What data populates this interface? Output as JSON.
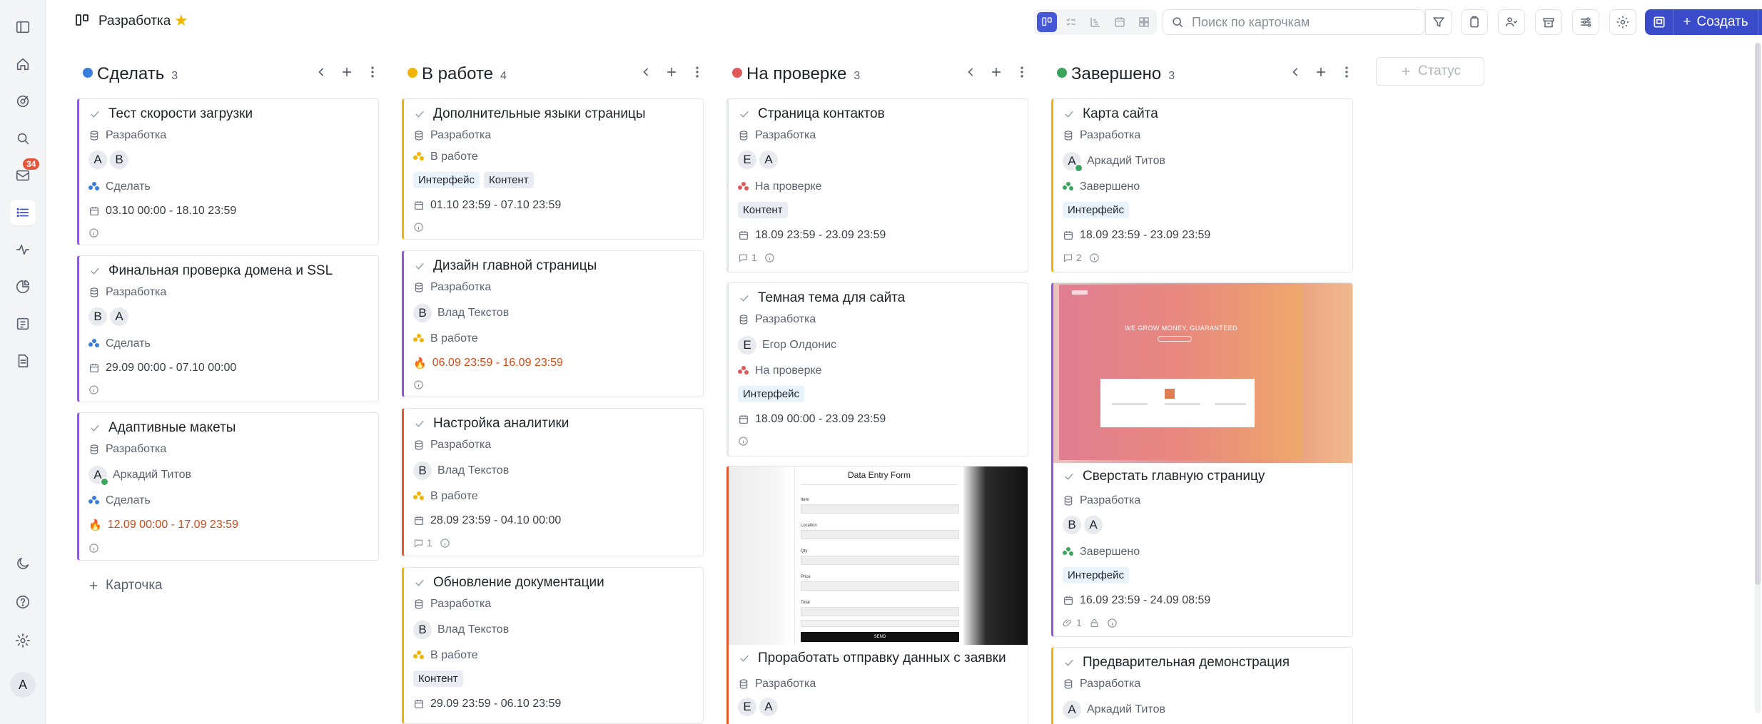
{
  "project": {
    "title": "Разработка"
  },
  "sidebar": {
    "inbox_badge": "34",
    "avatar": "А"
  },
  "toolbar": {
    "search_placeholder": "Поиск по карточкам",
    "create_label": "Создать"
  },
  "board": {
    "add_card_label": "Карточка",
    "add_status_label": "Статус",
    "columns": [
      {
        "title": "Сделать",
        "count": "3",
        "color": "#3b7ddd",
        "cards": [
          {
            "title": "Тест скорости загрузки",
            "project": "Разработка",
            "avatars": [
              "А",
              "В"
            ],
            "status": "Сделать",
            "date": "03.10 00:00 - 18.10 23:59"
          },
          {
            "title": "Финальная проверка домена и SSL",
            "project": "Разработка",
            "avatars": [
              "В",
              "А"
            ],
            "status": "Сделать",
            "date": "29.09 00:00 - 07.10 00:00"
          },
          {
            "title": "Адаптивные макеты",
            "project": "Разработка",
            "avatars": [
              "А"
            ],
            "assignee": "Аркадий Титов",
            "status": "Сделать",
            "date": "12.09 00:00 - 17.09 23:59"
          }
        ]
      },
      {
        "title": "В работе",
        "count": "4",
        "color": "#f0b400",
        "cards": [
          {
            "title": "Дополнительные языки страницы",
            "project": "Разработка",
            "status": "В работе",
            "tags": [
              "Интерфейс",
              "Контент"
            ],
            "date": "01.10 23:59 - 07.10 23:59"
          },
          {
            "title": "Дизайн главной страницы",
            "project": "Разработка",
            "avatars": [
              "В"
            ],
            "assignee": "Влад Текстов",
            "status": "В работе",
            "date": "06.09 23:59 - 16.09 23:59"
          },
          {
            "title": "Настройка аналитики",
            "project": "Разработка",
            "avatars": [
              "В"
            ],
            "assignee": "Влад Текстов",
            "status": "В работе",
            "date": "28.09 23:59 - 04.10 00:00",
            "comments": "1"
          },
          {
            "title": "Обновление документации",
            "project": "Разработка",
            "avatars": [
              "В"
            ],
            "assignee": "Влад Текстов",
            "status": "В работе",
            "tags": [
              "Контент"
            ],
            "date": "29.09 23:59 - 06.10 23:59"
          }
        ]
      },
      {
        "title": "На проверке",
        "count": "3",
        "color": "#e05a5a",
        "cards": [
          {
            "title": "Страница контактов",
            "project": "Разработка",
            "avatars": [
              "Е",
              "А"
            ],
            "status": "На проверке",
            "tags": [
              "Контент"
            ],
            "date": "18.09 23:59 - 23.09 23:59",
            "comments": "1"
          },
          {
            "title": "Темная тема для сайта",
            "project": "Разработка",
            "avatars": [
              "Е"
            ],
            "assignee": "Егор Олдонис",
            "status": "На проверке",
            "tags": [
              "Интерфейс"
            ],
            "date": "18.09 00:00 - 23.09 23:59"
          },
          {
            "title": "Проработать отправку данных с заявки",
            "project": "Разработка",
            "avatars": [
              "Е",
              "А"
            ],
            "cover": {
              "form_title": "Data Entry Form",
              "labels": [
                "Item",
                "Location",
                "Qty",
                "Price",
                "Total"
              ],
              "send": "SEND"
            }
          }
        ]
      },
      {
        "title": "Завершено",
        "count": "3",
        "color": "#3aa55d",
        "cards": [
          {
            "title": "Карта сайта",
            "project": "Разработка",
            "avatars": [
              "А"
            ],
            "assignee": "Аркадий Титов",
            "status": "Завершено",
            "tags": [
              "Интерфейс"
            ],
            "date": "18.09 23:59 - 23.09 23:59",
            "comments": "2"
          },
          {
            "title": "Сверстать главную страницу",
            "project": "Разработка",
            "avatars": [
              "В",
              "А"
            ],
            "status": "Завершено",
            "tags": [
              "Интерфейс"
            ],
            "date": "16.09 23:59 - 24.09 08:59",
            "attachments": "1",
            "cover": {
              "headline": "WE GROW MONEY, GUARANTEED"
            }
          },
          {
            "title": "Предварительная демонстрация",
            "project": "Разработка",
            "avatars": [
              "А"
            ],
            "assignee": "Аркадий Титов"
          }
        ]
      }
    ]
  }
}
